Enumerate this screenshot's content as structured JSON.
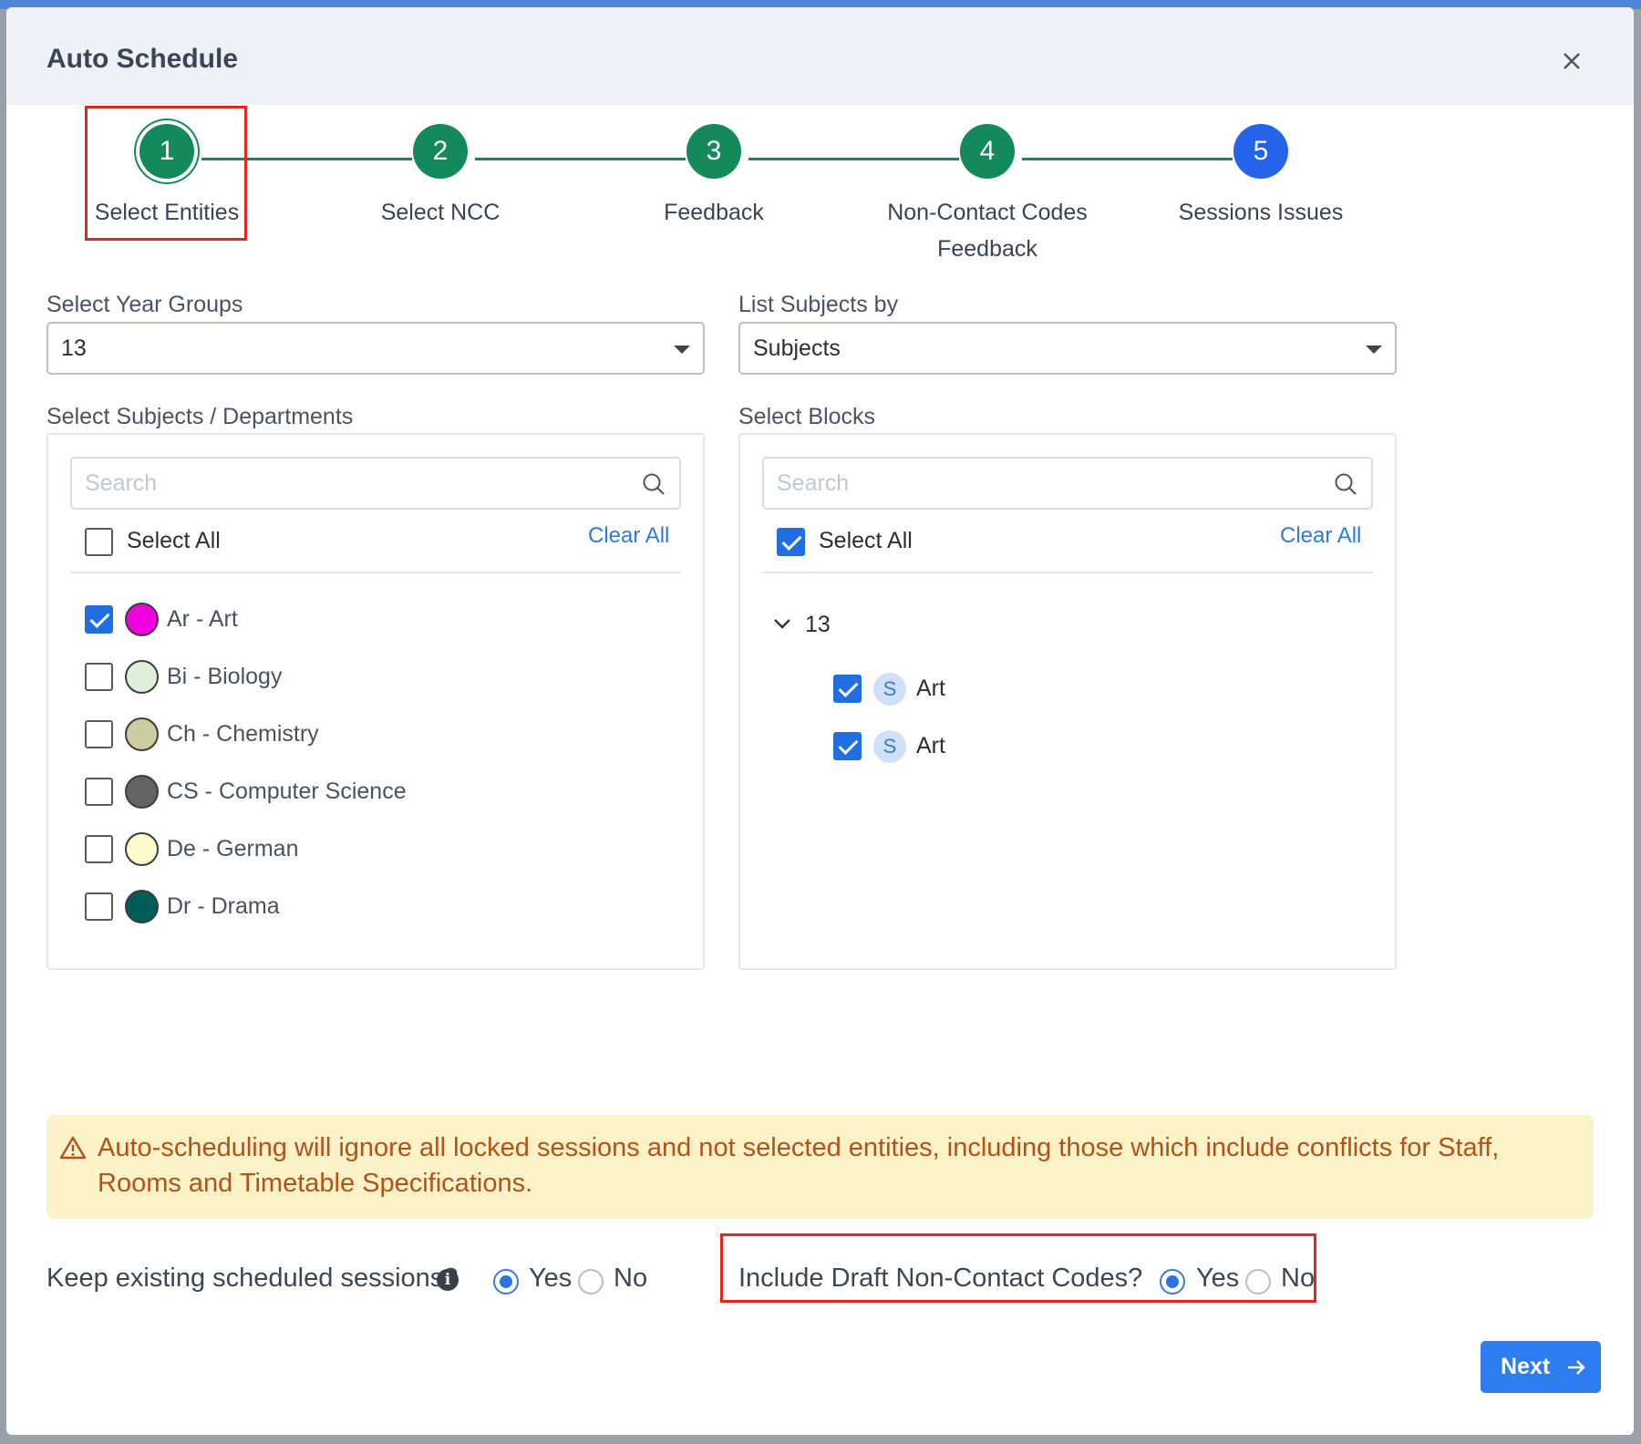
{
  "modal": {
    "title": "Auto Schedule"
  },
  "stepper": {
    "steps": [
      {
        "number": "1",
        "label": "Select Entities",
        "color": "#13895c"
      },
      {
        "number": "2",
        "label": "Select NCC",
        "color": "#13895c"
      },
      {
        "number": "3",
        "label": "Feedback",
        "color": "#13895c"
      },
      {
        "number": "4",
        "label": "Non-Contact Codes Feedback",
        "color": "#13895c"
      },
      {
        "number": "5",
        "label": "Sessions Issues",
        "color": "#2563eb"
      }
    ]
  },
  "year_groups": {
    "label": "Select Year Groups",
    "value": "13"
  },
  "list_by": {
    "label": "List Subjects by",
    "value": "Subjects"
  },
  "subjects": {
    "label": "Select Subjects / Departments",
    "search_placeholder": "Search",
    "select_all_label": "Select All",
    "clear_all_label": "Clear All",
    "items": [
      {
        "label": "Ar - Art",
        "checked": true,
        "color": "#f000e0"
      },
      {
        "label": "Bi - Biology",
        "checked": false,
        "color": "#e0eedb"
      },
      {
        "label": "Ch - Chemistry",
        "checked": false,
        "color": "#cccca0"
      },
      {
        "label": "CS - Computer Science",
        "checked": false,
        "color": "#636363"
      },
      {
        "label": "De - German",
        "checked": false,
        "color": "#fbfbcc"
      },
      {
        "label": "Dr - Drama",
        "checked": false,
        "color": "#005e5a"
      }
    ]
  },
  "blocks": {
    "label": "Select Blocks",
    "search_placeholder": "Search",
    "select_all_label": "Select All",
    "clear_all_label": "Clear All",
    "group_label": "13",
    "items": [
      {
        "badge": "S",
        "label": "Art",
        "checked": true
      },
      {
        "badge": "S",
        "label": "Art",
        "checked": true
      }
    ]
  },
  "alert": {
    "text": "Auto-scheduling will ignore all locked sessions and not selected entities, including those which include conflicts for Staff, Rooms and Timetable Specifications."
  },
  "keep_existing": {
    "question": "Keep existing scheduled sessions?",
    "yes_label": "Yes",
    "no_label": "No",
    "selected": "Yes"
  },
  "include_draft": {
    "question": "Include Draft Non-Contact Codes?",
    "yes_label": "Yes",
    "no_label": "No",
    "selected": "Yes"
  },
  "footer": {
    "next_label": "Next"
  }
}
